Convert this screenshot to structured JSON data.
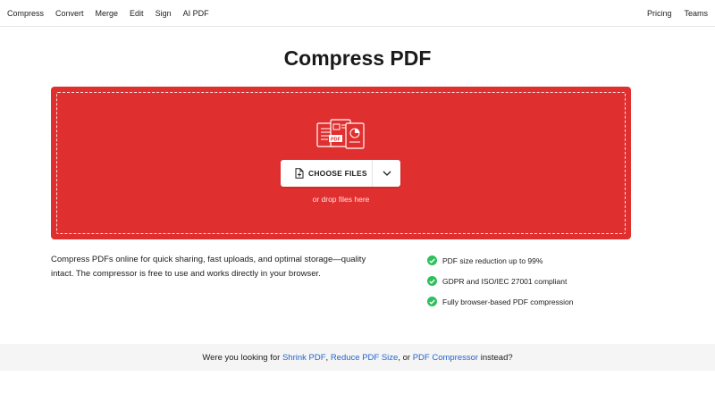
{
  "nav": {
    "left_items": [
      {
        "label": "Compress"
      },
      {
        "label": "Convert"
      },
      {
        "label": "Merge"
      },
      {
        "label": "Edit"
      },
      {
        "label": "Sign"
      },
      {
        "label": "AI PDF"
      }
    ],
    "right_items": [
      {
        "label": "Pricing"
      },
      {
        "label": "Teams"
      }
    ]
  },
  "page": {
    "title": "Compress PDF"
  },
  "dropzone": {
    "color": "#e02f2f",
    "illustration_icon": "pdf-files-icon",
    "choose_button_label": "CHOOSE FILES",
    "choose_button_icon": "file-add-icon",
    "dropdown_icon": "chevron-down-icon",
    "hint": "or drop files here"
  },
  "description": "Compress PDFs online for quick sharing, fast uploads, and optimal storage—quality intact. The compressor is free to use and works directly in your browser.",
  "features": [
    {
      "text": "PDF size reduction up to 99%",
      "icon": "check-circle-icon"
    },
    {
      "text": "GDPR and ISO/IEC 27001 compliant",
      "icon": "check-circle-icon"
    },
    {
      "text": "Fully browser-based PDF compression",
      "icon": "check-circle-icon"
    }
  ],
  "suggestion": {
    "prefix": "Were you looking for ",
    "link1": "Shrink PDF",
    "sep1": ", ",
    "link2": "Reduce PDF Size",
    "sep2": ", or ",
    "link3": "PDF Compressor",
    "suffix": " instead?",
    "link_color": "#2165d1"
  }
}
